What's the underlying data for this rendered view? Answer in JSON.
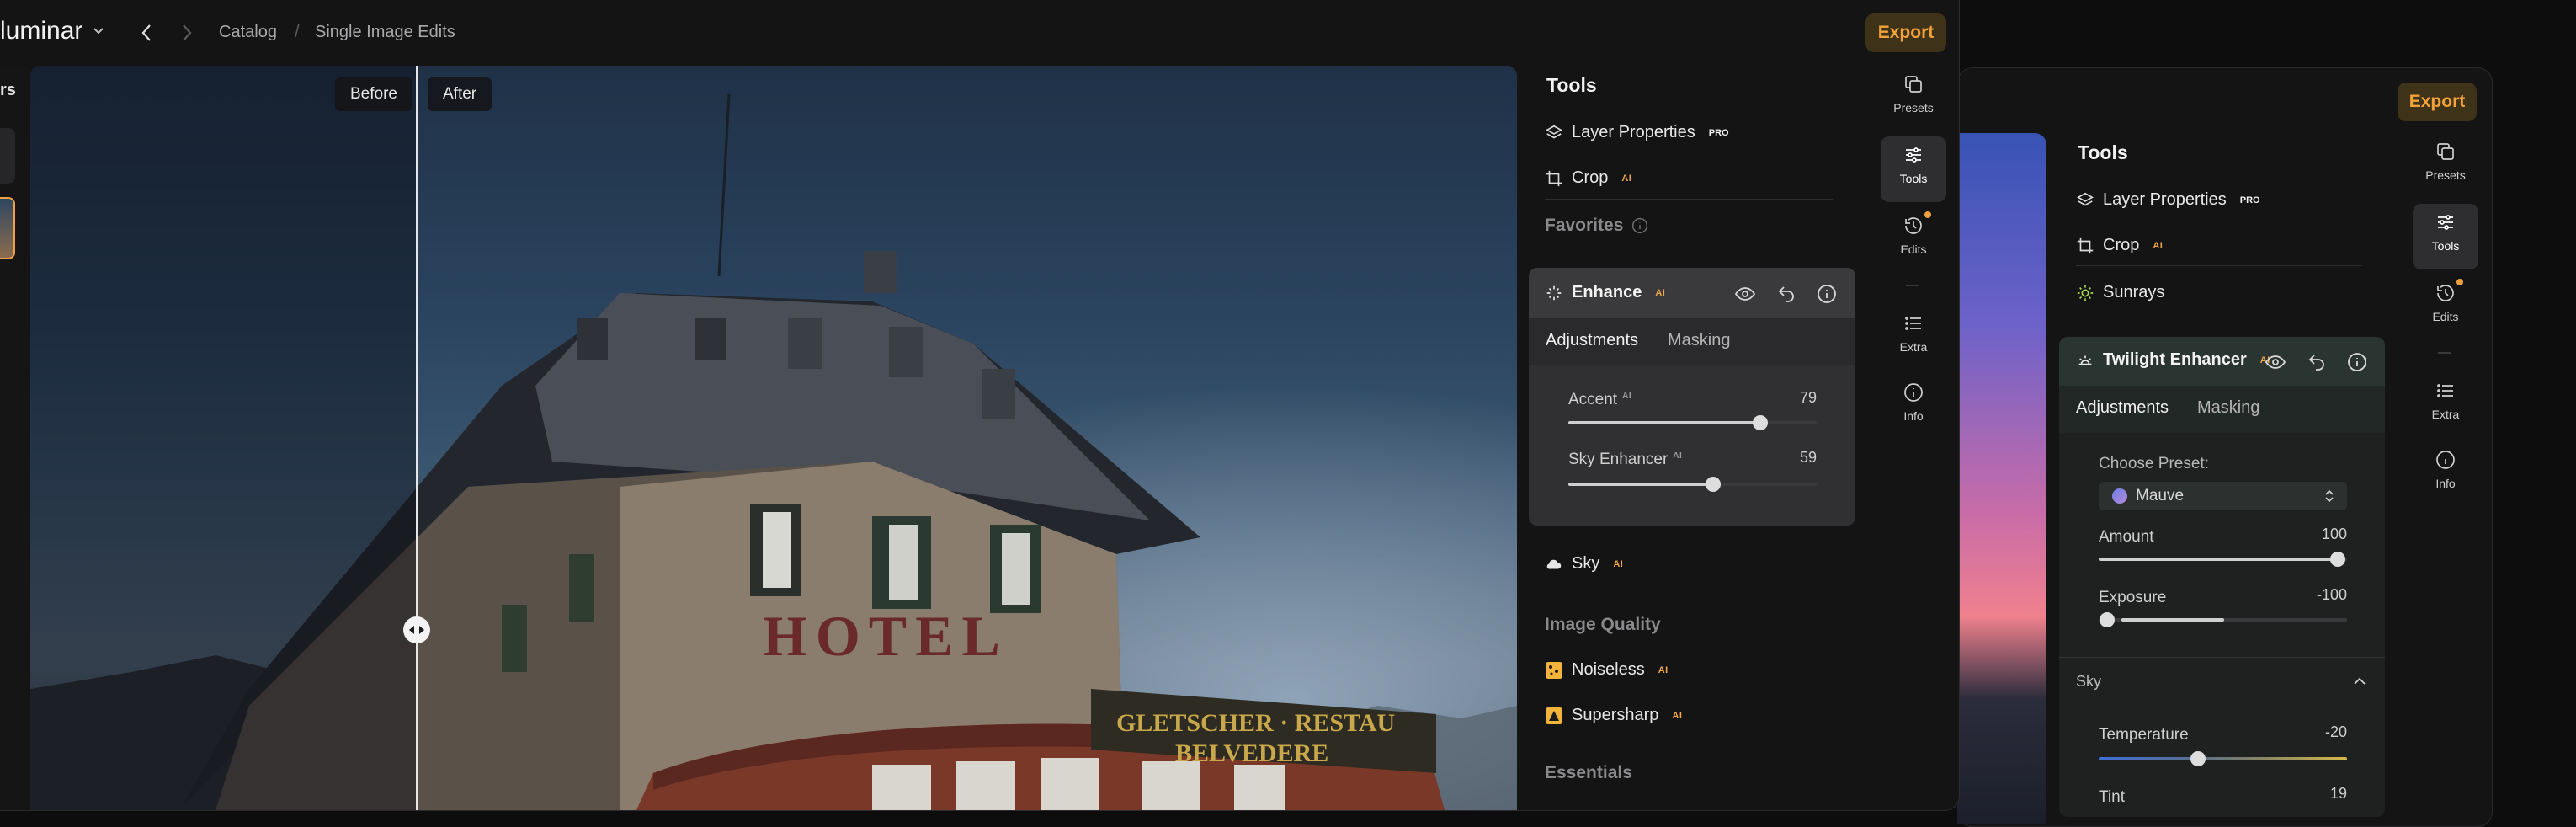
{
  "main": {
    "brand": "luminar",
    "breadcrumb": [
      "Catalog",
      "/",
      "Single Image Edits"
    ],
    "export_label": "Export",
    "left_label": "rs",
    "compare": {
      "before": "Before",
      "after": "After"
    },
    "tools_title": "Tools",
    "layer_properties": "Layer Properties",
    "pro_badge": "PRO",
    "ai_badge": "AI",
    "crop": "Crop",
    "favorites": "Favorites",
    "enhance": {
      "title": "Enhance",
      "tabs": [
        "Adjustments",
        "Masking"
      ],
      "sliders": [
        {
          "label": "Accent",
          "value": "79",
          "level": 79
        },
        {
          "label": "Sky Enhancer",
          "value": "59",
          "level": 59
        }
      ]
    },
    "sky": "Sky",
    "image_quality": "Image Quality",
    "noiseless": "Noiseless",
    "supersharp": "Supersharp",
    "essentials": "Essentials",
    "rail": [
      "Presets",
      "Tools",
      "Edits",
      "Extra",
      "Info"
    ]
  },
  "second": {
    "export_label": "Export",
    "tools_title": "Tools",
    "layer_properties": "Layer Properties",
    "crop": "Crop",
    "sunrays": "Sunrays",
    "twilight": {
      "title": "Twilight Enhancer",
      "tabs": [
        "Adjustments",
        "Masking"
      ],
      "choose_preset": "Choose Preset:",
      "preset_value": "Mauve",
      "amount": {
        "label": "Amount",
        "value": "100",
        "level": 100
      },
      "exposure": {
        "label": "Exposure",
        "value": "-100",
        "level": -100
      },
      "sky_section": "Sky",
      "temperature": {
        "label": "Temperature",
        "value": "-20",
        "level": -20
      },
      "tint": {
        "label": "Tint",
        "value": "19"
      }
    },
    "rail": [
      "Presets",
      "Tools",
      "Edits",
      "Extra",
      "Info"
    ]
  },
  "photo_sign": {
    "line1": "GLETSCHER · RESTAU",
    "line2": "BELVEDERE",
    "hotel": "HOTEL"
  },
  "colors": {
    "accent": "#f3a23a",
    "ai_badge": "#f0a64a",
    "background": "#141415"
  }
}
